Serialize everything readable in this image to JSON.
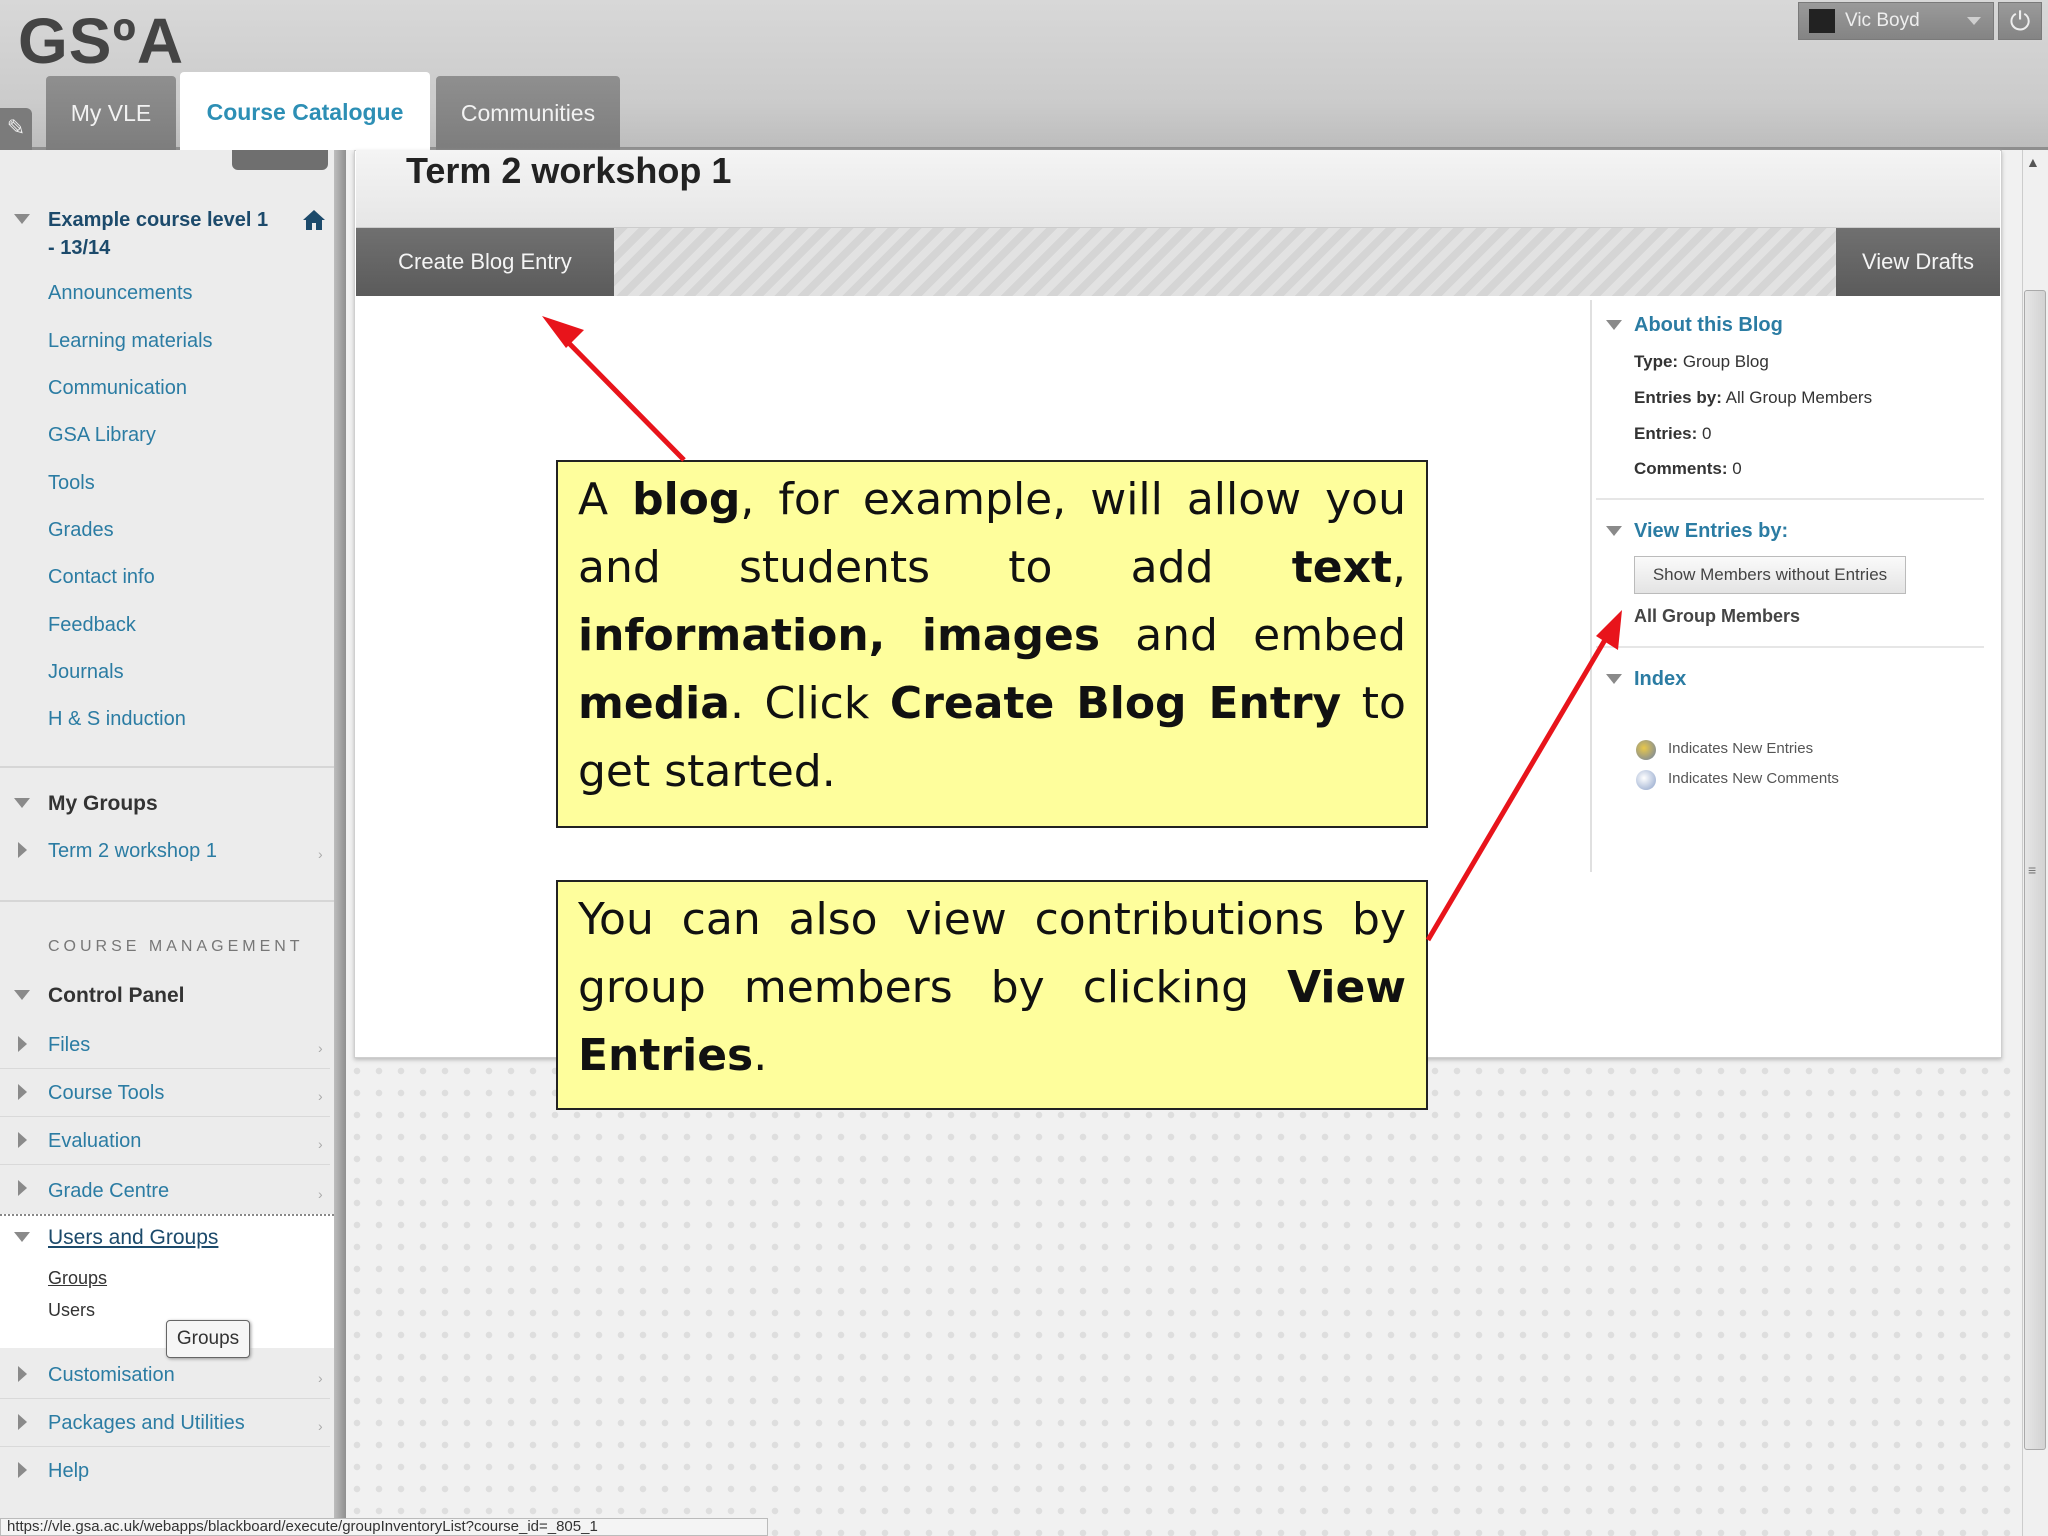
{
  "header": {
    "logo_text": "GSºA",
    "user_name": "Vic Boyd",
    "tabs": [
      {
        "label": "My VLE"
      },
      {
        "label": "Course Catalogue"
      },
      {
        "label": "Communities"
      }
    ]
  },
  "sidebar": {
    "course_title": "Example course level 1 - 13/14",
    "course_links": [
      "Announcements",
      "Learning materials",
      "Communication",
      "GSA Library",
      "Tools",
      "Grades",
      "Contact info",
      "Feedback",
      "Journals",
      "H & S induction"
    ],
    "my_groups_heading": "My Groups",
    "group_item": "Term 2 workshop 1",
    "course_management_label": "COURSE MANAGEMENT",
    "control_panel_heading": "Control Panel",
    "control_items": [
      "Files",
      "Course Tools",
      "Evaluation",
      "Grade Centre"
    ],
    "users_and_groups": "Users and Groups",
    "sub_groups": "Groups",
    "sub_users": "Users",
    "tooltip": "Groups",
    "bottom_items": [
      "Customisation",
      "Packages and Utilities",
      "Help"
    ]
  },
  "main": {
    "page_title": "Term 2 workshop 1",
    "create_button": "Create Blog Entry",
    "drafts_button": "View Drafts"
  },
  "blog_sidebar": {
    "about_heading": "About this Blog",
    "type_label": "Type:",
    "type_value": "Group Blog",
    "entries_by_label": "Entries by:",
    "entries_by_value": "All Group Members",
    "entries_label": "Entries:",
    "entries_value": "0",
    "comments_label": "Comments:",
    "comments_value": "0",
    "view_entries_heading": "View Entries by:",
    "show_members_button": "Show Members without Entries",
    "all_members_label": "All Group Members",
    "index_heading": "Index",
    "legend_new_entries": "Indicates New Entries",
    "legend_new_comments": "Indicates New Comments"
  },
  "status_bar": "https://vle.gsa.ac.uk/webapps/blackboard/execute/groupInventoryList?course_id=_805_1",
  "callouts": {
    "one": {
      "p1": "A ",
      "b1": "blog",
      "p2": ", for example, will allow you and students to add ",
      "b2": "text",
      "p3": ", ",
      "b3": "information, images",
      "p4": " and embed ",
      "b4": "media",
      "p5": ". Click ",
      "b5": "Create Blog Entry",
      "p6": " to get started."
    },
    "two": {
      "p1": "You can also view contributions by group members by clicking ",
      "b1": "View Entries",
      "p2": "."
    }
  },
  "colors": {
    "accent_link": "#2b7ca3",
    "callout_bg": "#fefe9c",
    "arrow": "#e8141b"
  }
}
